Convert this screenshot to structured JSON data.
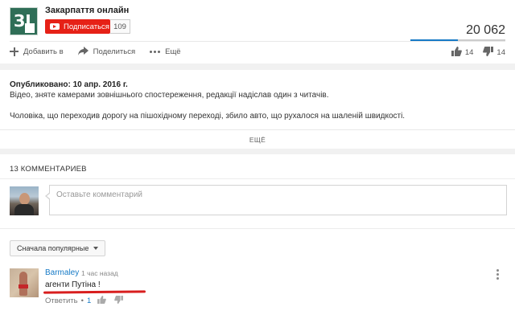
{
  "channel": {
    "name": "Закарпаття онлайн",
    "subscribe_label": "Подписаться",
    "subscriber_count": "109",
    "logo_icon": "channel-logo"
  },
  "video": {
    "views": "20 062",
    "like_ratio": 0.5,
    "likes": "14",
    "dislikes": "14"
  },
  "actions": {
    "add": "Добавить в",
    "share": "Поделиться",
    "more": "Ещё"
  },
  "description": {
    "published": "Опубликовано: 10 апр. 2016 г.",
    "line1": "Відео, зняте камерами зовнішнього спостереження, редакції надіслав один з читачів.",
    "line2": "Чоловіка, що переходив дорогу на пішохідному переході, збило авто, що рухалося на шаленій швидкості.",
    "more_label": "ЕЩЁ"
  },
  "comments": {
    "header": "13 КОММЕНТАРИЕВ",
    "input_placeholder": "Оставьте комментарий",
    "sort_label": "Сначала популярные",
    "items": [
      {
        "author": "Barmaley",
        "time": "1 час назад",
        "text": "агенти Путіна !",
        "reply_label": "Ответить",
        "likes": "1"
      }
    ]
  },
  "colors": {
    "subscribe": "#e62117",
    "link": "#167ac6",
    "underline": "#d81e1e"
  }
}
